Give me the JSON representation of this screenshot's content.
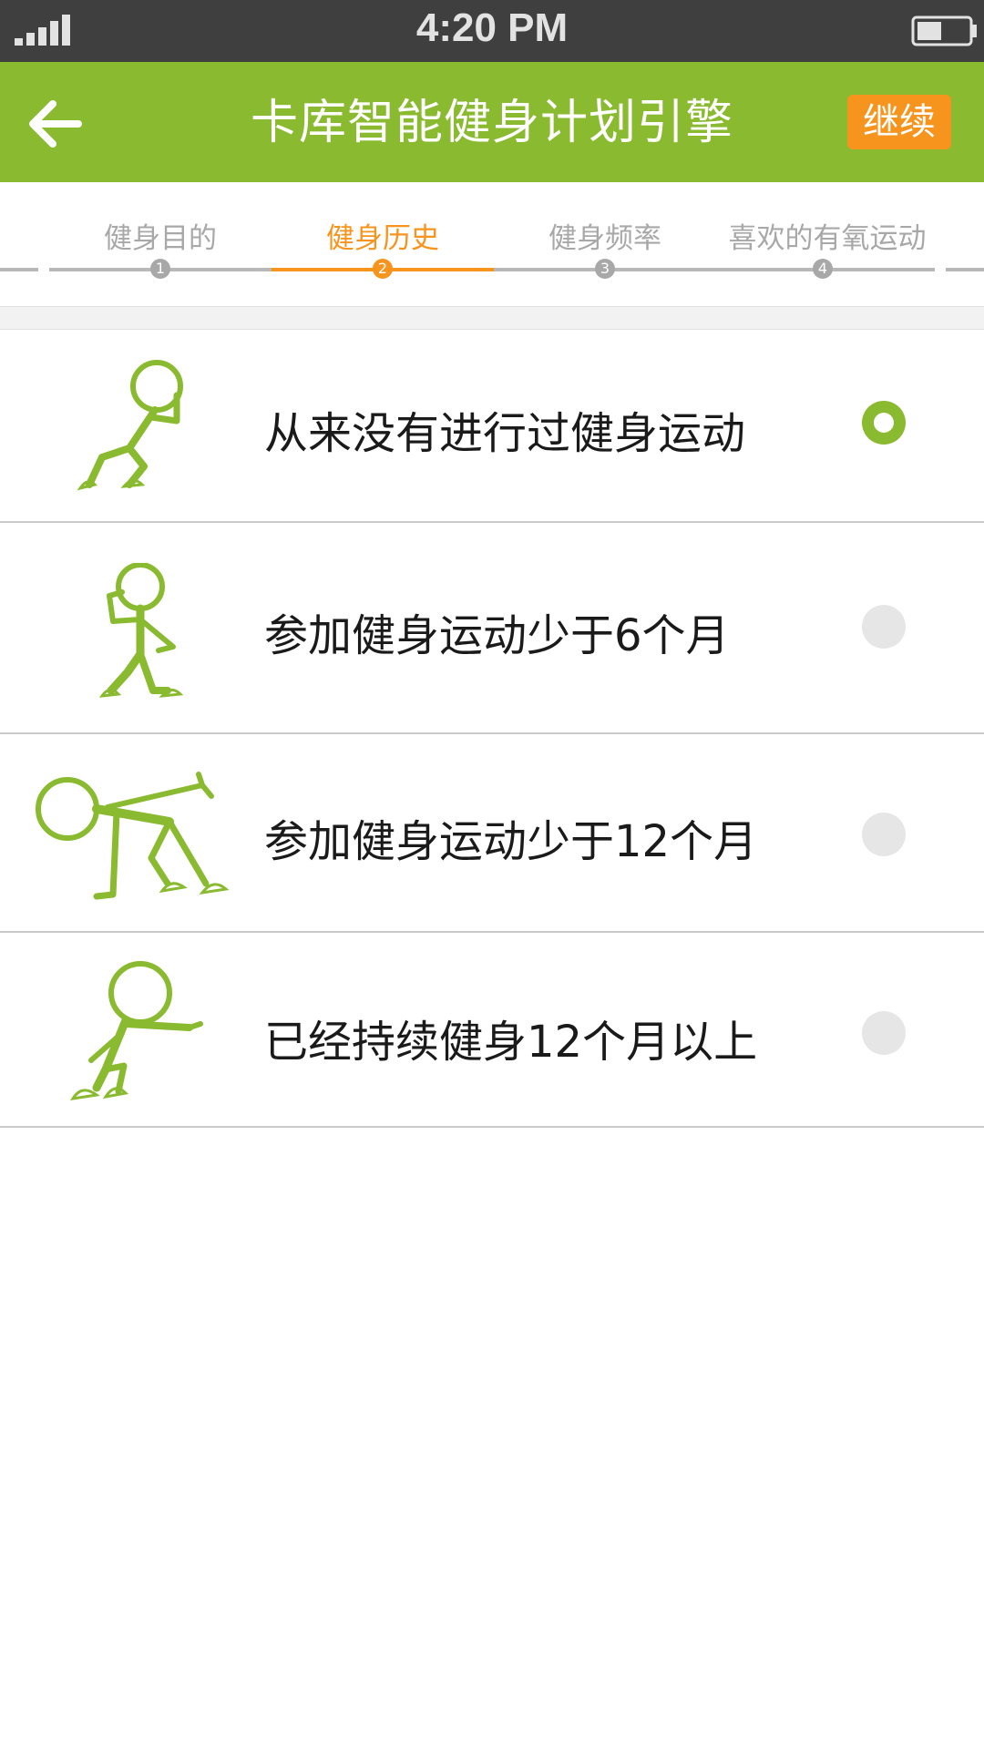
{
  "status_bar": {
    "time": "4:20 PM",
    "signal_icon": "signal-bars-icon",
    "battery_icon": "battery-icon"
  },
  "nav": {
    "back_icon": "arrow-left-icon",
    "title": "卡库智能健身计划引擎",
    "continue_label": "继续",
    "color_primary": "#8aba2f",
    "color_accent": "#f7941d"
  },
  "steps": [
    {
      "label": "健身目的",
      "number": "1",
      "active": false
    },
    {
      "label": "健身历史",
      "number": "2",
      "active": true
    },
    {
      "label": "健身频率",
      "number": "3",
      "active": false
    },
    {
      "label": "喜欢的有氧运动",
      "number": "4",
      "active": false
    }
  ],
  "options": [
    {
      "label": "从来没有进行过健身运动",
      "selected": true,
      "icon": "stick-figure-thinking-icon"
    },
    {
      "label": "参加健身运动少于6个月",
      "selected": false,
      "icon": "stick-figure-squat-icon"
    },
    {
      "label": "参加健身运动少于12个月",
      "selected": false,
      "icon": "stick-figure-stretch-icon"
    },
    {
      "label": "已经持续健身12个月以上",
      "selected": false,
      "icon": "stick-figure-lunge-icon"
    }
  ]
}
